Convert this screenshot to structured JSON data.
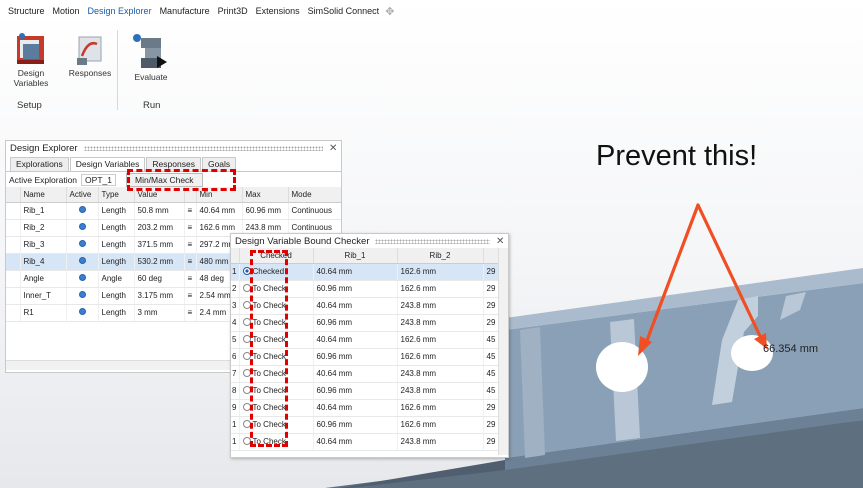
{
  "menu": {
    "items": [
      "Structure",
      "Motion",
      "Design Explorer",
      "Manufacture",
      "Print3D",
      "Extensions",
      "SimSolid Connect"
    ],
    "active": "Design Explorer"
  },
  "ribbon": {
    "design_variables_label": "Design Variables",
    "responses_label": "Responses",
    "evaluate_label": "Evaluate",
    "setup_group": "Setup",
    "run_group": "Run"
  },
  "explorer": {
    "title": "Design Explorer",
    "tabs": [
      "Explorations",
      "Design Variables",
      "Responses",
      "Goals"
    ],
    "selected_tab": "Design Variables",
    "active_exploration_label": "Active Exploration",
    "active_exploration_value": "OPT_1",
    "minmax_button": "Min/Max Check",
    "columns": [
      "Name",
      "Active",
      "Type",
      "Value",
      "",
      "Min",
      "Max",
      "Mode"
    ],
    "rows": [
      {
        "name": "Rib_1",
        "type": "Length",
        "value": "50.8 mm",
        "min": "40.64 mm",
        "max": "60.96 mm",
        "mode": "Continuous"
      },
      {
        "name": "Rib_2",
        "type": "Length",
        "value": "203.2 mm",
        "min": "162.6 mm",
        "max": "243.8 mm",
        "mode": "Continuous"
      },
      {
        "name": "Rib_3",
        "type": "Length",
        "value": "371.5 mm",
        "min": "297.2 mm",
        "max": "",
        "mode": ""
      },
      {
        "name": "Rib_4",
        "type": "Length",
        "value": "530.2 mm",
        "min": "480 mm",
        "max": "",
        "mode": ""
      },
      {
        "name": "Angle",
        "type": "Angle",
        "value": "60 deg",
        "min": "48 deg",
        "max": "",
        "mode": ""
      },
      {
        "name": "Inner_T",
        "type": "Length",
        "value": "3.175 mm",
        "min": "2.54 mm",
        "max": "",
        "mode": ""
      },
      {
        "name": "R1",
        "type": "Length",
        "value": "3 mm",
        "min": "2.4 mm",
        "max": "",
        "mode": ""
      }
    ]
  },
  "checker": {
    "title": "Design Variable Bound Checker",
    "columns": [
      "",
      "Checked",
      "Rib_1",
      "Rib_2",
      ""
    ],
    "rows": [
      {
        "n": "1",
        "status": "Checked",
        "rib1": "40.64 mm",
        "rib2": "162.6 mm",
        "c4": "29"
      },
      {
        "n": "2",
        "status": "To Check",
        "rib1": "60.96 mm",
        "rib2": "162.6 mm",
        "c4": "29"
      },
      {
        "n": "3",
        "status": "To Check",
        "rib1": "40.64 mm",
        "rib2": "243.8 mm",
        "c4": "29"
      },
      {
        "n": "4",
        "status": "To Check",
        "rib1": "60.96 mm",
        "rib2": "243.8 mm",
        "c4": "29"
      },
      {
        "n": "5",
        "status": "To Check",
        "rib1": "40.64 mm",
        "rib2": "162.6 mm",
        "c4": "45"
      },
      {
        "n": "6",
        "status": "To Check",
        "rib1": "60.96 mm",
        "rib2": "162.6 mm",
        "c4": "45"
      },
      {
        "n": "7",
        "status": "To Check",
        "rib1": "40.64 mm",
        "rib2": "243.8 mm",
        "c4": "45"
      },
      {
        "n": "8",
        "status": "To Check",
        "rib1": "60.96 mm",
        "rib2": "243.8 mm",
        "c4": "45"
      },
      {
        "n": "9",
        "status": "To Check",
        "rib1": "40.64 mm",
        "rib2": "162.6 mm",
        "c4": "29"
      },
      {
        "n": "1",
        "status": "To Check",
        "rib1": "60.96 mm",
        "rib2": "162.6 mm",
        "c4": "29"
      },
      {
        "n": "1",
        "status": "To Check",
        "rib1": "40.64 mm",
        "rib2": "243.8 mm",
        "c4": "29"
      }
    ]
  },
  "annotation": {
    "callout": "Prevent this!",
    "dimension": "66.354 mm"
  },
  "colors": {
    "accent": "#1b5aa6",
    "arrow": "#f04e23",
    "highlight_dash": "#e00000",
    "model_blue": "#7f96ad"
  }
}
